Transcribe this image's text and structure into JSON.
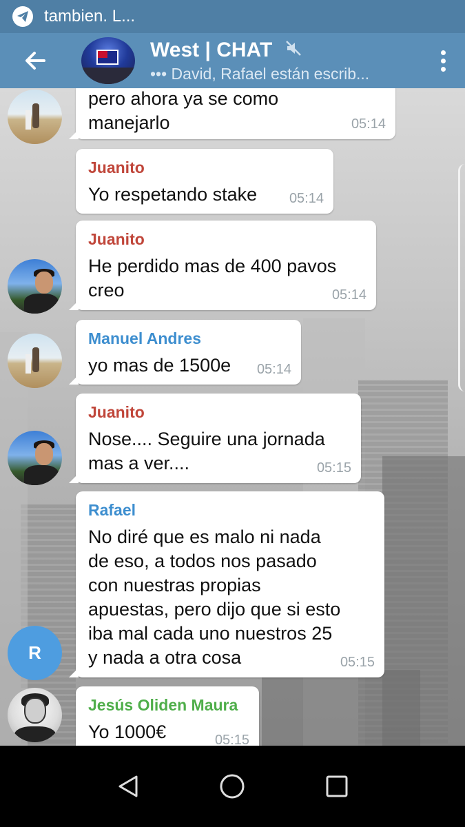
{
  "notification": {
    "text": "tambien. L...",
    "icon": "telegram-icon"
  },
  "header": {
    "title": "West | CHAT",
    "subtitle": "••• David, Rafael están escrib...",
    "muted_icon": "muted-speaker-icon",
    "back_icon": "back-arrow-icon",
    "menu_icon": "more-vertical-icon"
  },
  "colors": {
    "header": "#5b8fb8",
    "juanito": "#c0463a",
    "manuel": "#3d8ecf",
    "rafael": "#3d8ecf",
    "jesus": "#4fae4a"
  },
  "messages": [
    {
      "sender": "",
      "text_lines": [
        "pero ahora ya se como",
        "manejarlo"
      ],
      "time": "05:14"
    },
    {
      "sender": "Juanito",
      "text_lines": [
        "Yo respetando stake"
      ],
      "time": "05:14"
    },
    {
      "sender": "Juanito",
      "text_lines": [
        "He perdido mas de 400 pavos",
        "creo"
      ],
      "time": "05:14"
    },
    {
      "sender": "Manuel Andres",
      "text_lines": [
        "yo mas de 1500e"
      ],
      "time": "05:14"
    },
    {
      "sender": "Juanito",
      "text_lines": [
        "Nose.... Seguire una jornada",
        "mas a ver...."
      ],
      "time": "05:15"
    },
    {
      "sender": "Rafael",
      "text_lines": [
        "No diré que es malo ni nada",
        "de eso, a todos nos pasado",
        "con nuestras propias",
        "apuestas, pero dijo que si esto",
        "iba mal cada uno nuestros 25",
        "y nada a otra cosa"
      ],
      "time": "05:15",
      "avatar_letter": "R"
    },
    {
      "sender": "Jesús Oliden Maura",
      "text_lines": [
        "Yo 1000€"
      ],
      "time": "05:15"
    }
  ],
  "navbar": {
    "back": "nav-back-icon",
    "home": "nav-home-icon",
    "recents": "nav-recents-icon"
  }
}
